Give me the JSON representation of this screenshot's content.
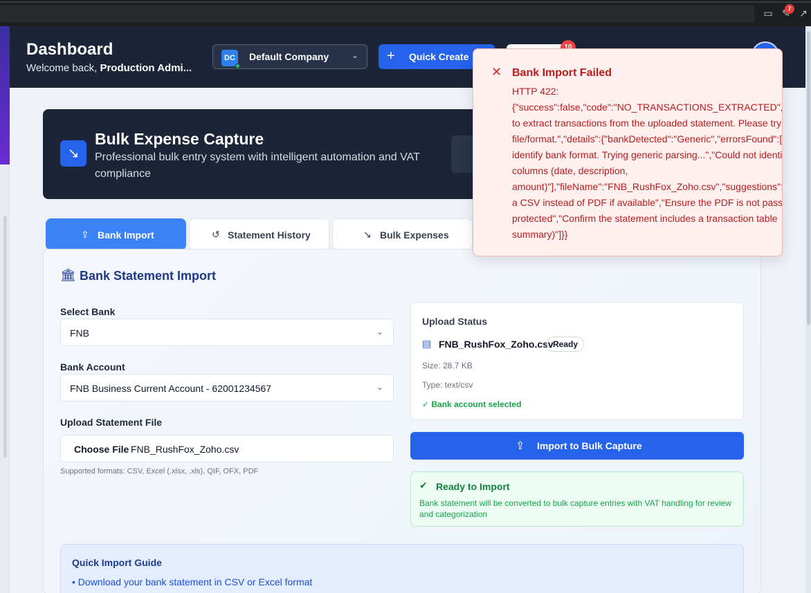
{
  "browser": {
    "extension_badge": "7"
  },
  "header": {
    "title": "Dashboard",
    "welcome_prefix": "Welcome back, ",
    "welcome_user": "Production Admi...",
    "company_initials": "DC",
    "company_name": "Default Company",
    "quick_create_label": "Quick Create",
    "notification_count": "10"
  },
  "hero": {
    "title": "Bulk Expense Capture",
    "subtitle": "Professional bulk entry system with intelligent automation and VAT compliance"
  },
  "tabs": [
    {
      "label": "Bank Import",
      "icon": "upload-icon",
      "active": true
    },
    {
      "label": "Statement History",
      "icon": "history-icon",
      "active": false
    },
    {
      "label": "Bulk Expenses",
      "icon": "trend-down-icon",
      "active": false
    }
  ],
  "import_panel": {
    "title": "Bank Statement Import",
    "select_bank_label": "Select Bank",
    "select_bank_value": "FNB",
    "bank_account_label": "Bank Account",
    "bank_account_value": "FNB Business Current Account - 62001234567",
    "upload_label": "Upload Statement File",
    "choose_file_label": "Choose File",
    "chosen_file": "FNB_RushFox_Zoho.csv",
    "supported_formats": "Supported formats: CSV, Excel (.xlsx, .xls), QIF, OFX, PDF"
  },
  "upload_status": {
    "title": "Upload Status",
    "file_name": "FNB_RushFox_Zoho.csv",
    "badge": "Ready",
    "size": "Size: 28.7 KB",
    "type": "Type: text/csv",
    "account_selected": "✓ Bank account selected"
  },
  "import_button_label": "Import to Bulk Capture",
  "ready_card": {
    "title": "Ready to Import",
    "text": "Bank statement will be converted to bulk capture entries with VAT handling for review and categorization"
  },
  "guide": {
    "title": "Quick Import Guide",
    "item1": "• Download your bank statement in CSV or Excel format"
  },
  "toast": {
    "title": "Bank Import Failed",
    "body": "HTTP 422:\n{\"success\":false,\"code\":\"NO_TRANSACTIONS_EXTRACTED\",\"mes\nto extract transactions from the uploaded statement. Please try\nfile/format.\",\"details\":{\"bankDetected\":\"Generic\",\"errorsFound\":[\nidentify bank format. Trying generic parsing...\",\"Could not identi\ncolumns (date, description,\namount)\"],\"fileName\":\"FNB_RushFox_Zoho.csv\",\"suggestions\":[\"\na CSV instead of PDF if available\",\"Ensure the PDF is not passwo\nprotected\",\"Confirm the statement includes a transaction table\nsummary)\"]}}"
  }
}
